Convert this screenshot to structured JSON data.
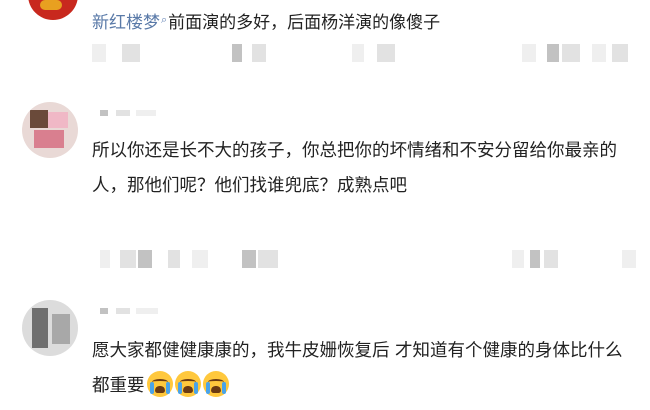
{
  "comments": [
    {
      "username": "新红楼梦",
      "badge_icon": "search-icon",
      "text": "前面演的多好，后面杨洋演的像傻子"
    },
    {
      "username": "",
      "text": "所以你还是长不大的孩子，你总把你的坏情绪和不安分留给你最亲的人，那他们呢？他们找谁兜底？成熟点吧"
    },
    {
      "username": "",
      "text": "愿大家都健健康康的，我牛皮姗恢复后 才知道有个健康的身体比什么都重要",
      "emoji_icon": "crying-face-icon",
      "emoji_count": 3
    }
  ]
}
